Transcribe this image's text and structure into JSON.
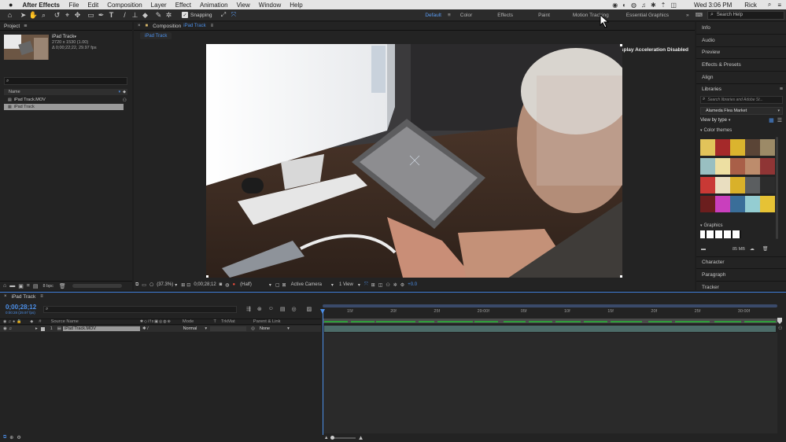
{
  "menubar": {
    "apple": "",
    "app_name": "After Effects",
    "menus": [
      "File",
      "Edit",
      "Composition",
      "Layer",
      "Effect",
      "Animation",
      "View",
      "Window",
      "Help"
    ],
    "clock": "Wed 3:06 PM",
    "user": "Rick"
  },
  "toolbar": {
    "snapping_label": "Snapping",
    "workspaces": [
      "Default",
      "Color",
      "Effects",
      "Paint",
      "Motion Tracking",
      "Essential Graphics"
    ],
    "active_workspace": "Default",
    "search_placeholder": "Search Help"
  },
  "project": {
    "title": "Project",
    "item_name": "iPad Track",
    "item_res": "2720 x 1530 (1.00)",
    "item_dur": "Δ 0;00;22;22, 29.97 fps",
    "column_name": "Name",
    "files": [
      "iPad Track.MOV",
      "iPad Track"
    ],
    "bpc": "8 bpc"
  },
  "composition": {
    "tab_prefix": "Composition",
    "tab_name": "iPad Track",
    "subtab": "iPad Track",
    "accel_message": "Display Acceleration Disabled",
    "zoom": "(37.3%)",
    "timecode": "0;00;28;12",
    "resolution": "(Half)",
    "camera": "Active Camera",
    "views": "1 View",
    "offset": "+0.0"
  },
  "right_panels": {
    "items_top": [
      "Info",
      "Audio",
      "Preview",
      "Effects & Presets",
      "Align"
    ],
    "libraries_title": "Libraries",
    "libraries_search_placeholder": "Search libraries and Adobe St...",
    "library_name": "Alameda Flea Market",
    "view_by": "View by type",
    "color_themes_label": "Color themes",
    "graphics_label": "Graphics",
    "storage": "85 MB",
    "items_bottom": [
      "Character",
      "Paragraph",
      "Tracker"
    ]
  },
  "color_themes": [
    [
      "#e2c35a",
      "#a5292a",
      "#dbb42e",
      "#5a4436",
      "#9c8a67"
    ],
    [
      "#99bfc1",
      "#eddfa2",
      "#a95f48",
      "#bd8c6c",
      "#8f3535"
    ],
    [
      "#c93935",
      "#e9dec0",
      "#d9b12a",
      "#5b5e60",
      "#2c2c2c"
    ],
    [
      "#6b1e1e",
      "#c93fbd",
      "#3a6e99",
      "#94cdd2",
      "#e6c235"
    ]
  ],
  "timeline": {
    "tab": "iPad Track",
    "timecode": "0;00;28;12",
    "frames": "0:00:28 (29.97 fps)",
    "columns": [
      "#",
      "Source Name",
      "Mode",
      "T",
      "TrkMat",
      "Parent & Link"
    ],
    "layer": {
      "num": "1",
      "name": "iPad Track.MOV",
      "mode": "Normal",
      "parent": "None"
    },
    "ticks": [
      "15f",
      "20f",
      "25f",
      "29:00f",
      "05f",
      "10f",
      "15f",
      "20f",
      "25f",
      "30:00f"
    ]
  }
}
